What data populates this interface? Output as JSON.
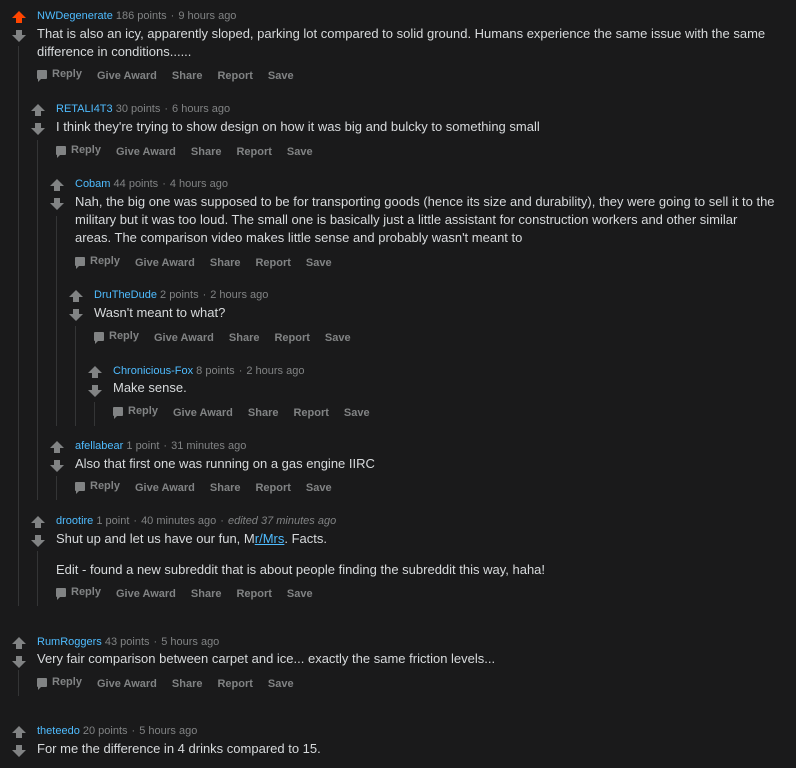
{
  "comments": [
    {
      "user": "NWDegenerate",
      "points": "186 points",
      "time": "9 hours ago",
      "body": "That is also an icy, apparently sloped, parking lot compared to solid ground. Humans experience the same issue with the same difference in conditions......",
      "upvoted": true
    },
    {
      "user": "RETALI4T3",
      "points": "30 points",
      "time": "6 hours ago",
      "body": "I think they're trying to show design on how it was big and bulcky to something small"
    },
    {
      "user": "Cobam",
      "points": "44 points",
      "time": "4 hours ago",
      "body": "Nah, the big one was supposed to be for transporting goods (hence its size and durability), they were going to sell it to the military but it was too loud. The small one is basically just a little assistant for construction workers and other similar areas. The comparison video makes little sense and probably wasn't meant to"
    },
    {
      "user": "DruTheDude",
      "points": "2 points",
      "time": "2 hours ago",
      "body": "Wasn't meant to what?"
    },
    {
      "user": "Chronicious-Fox",
      "points": "8 points",
      "time": "2 hours ago",
      "body": "Make sense."
    },
    {
      "user": "afellabear",
      "points": "1 point",
      "time": "31 minutes ago",
      "body": "Also that first one was running on a gas engine IIRC"
    },
    {
      "user": "drootire",
      "points": "1 point",
      "time": "40 minutes ago",
      "edited": "edited 37 minutes ago",
      "body_pre": "Shut up and let us have our fun, M",
      "body_link": "r/Mrs",
      "body_post": ". Facts.",
      "body2": "Edit - found a new subreddit that is about people finding the subreddit this way, haha!"
    },
    {
      "user": "RumRoggers",
      "points": "43 points",
      "time": "5 hours ago",
      "body": "Very fair comparison between carpet and ice... exactly the same friction levels..."
    },
    {
      "user": "theteedo",
      "points": "20 points",
      "time": "5 hours ago",
      "body": "For me the difference in 4 drinks compared to 15."
    }
  ],
  "actions": {
    "reply": "Reply",
    "give_award": "Give Award",
    "share": "Share",
    "report": "Report",
    "save": "Save"
  },
  "colors": {
    "background": "#1a1a1b",
    "username": "#4fbcff",
    "upvote_active": "#ff4500",
    "muted": "#818384",
    "text": "#d7dadc"
  }
}
